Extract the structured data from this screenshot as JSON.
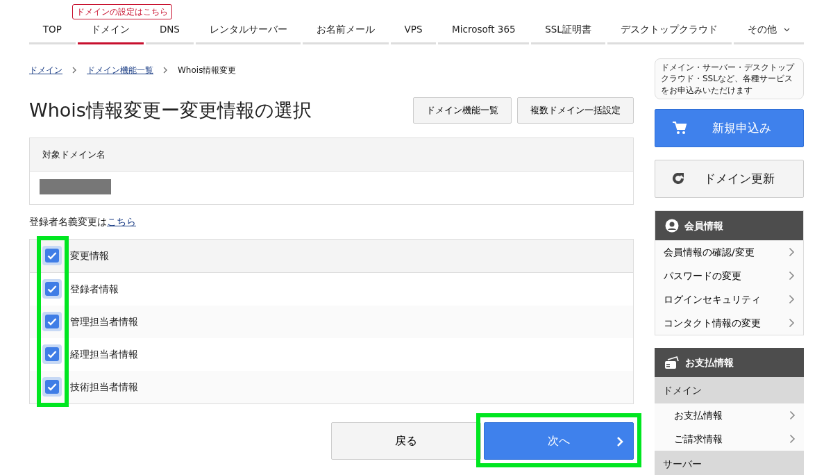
{
  "nav": {
    "tooltip": "ドメインの設定はこちら",
    "items": [
      {
        "label": "TOP",
        "selected": false
      },
      {
        "label": "ドメイン",
        "selected": true
      },
      {
        "label": "DNS",
        "selected": false
      },
      {
        "label": "レンタルサーバー",
        "selected": false
      },
      {
        "label": "お名前メール",
        "selected": false
      },
      {
        "label": "VPS",
        "selected": false
      },
      {
        "label": "Microsoft 365",
        "selected": false
      },
      {
        "label": "SSL証明書",
        "selected": false
      },
      {
        "label": "デスクトップクラウド",
        "selected": false
      },
      {
        "label": "その他",
        "selected": false,
        "dropdown": true
      }
    ]
  },
  "breadcrumb": [
    {
      "label": "ドメイン",
      "link": true
    },
    {
      "label": "ドメイン機能一覧",
      "link": true
    },
    {
      "label": "Whois情報変更",
      "link": false
    }
  ],
  "title": "Whois情報変更ー変更情報の選択",
  "header_buttons": [
    "ドメイン機能一覧",
    "複数ドメイン一括設定"
  ],
  "domain_panel": {
    "heading": "対象ドメイン名",
    "redacted": true
  },
  "registrant_note": {
    "text": "登録者名義変更は",
    "link": "こちら"
  },
  "options": {
    "highlighted": true,
    "items": [
      {
        "label": "変更情報",
        "checked": true,
        "kind": "header"
      },
      {
        "label": "登録者情報",
        "checked": true,
        "kind": "row"
      },
      {
        "label": "管理担当者情報",
        "checked": true,
        "kind": "row"
      },
      {
        "label": "経理担当者情報",
        "checked": true,
        "kind": "row"
      },
      {
        "label": "技術担当者情報",
        "checked": true,
        "kind": "row"
      }
    ]
  },
  "back_button": "戻る",
  "next_button": {
    "label": "次へ",
    "highlighted": true
  },
  "sidebar": {
    "bubble": "ドメイン・サーバー・デスクトップクラウド・SSLなど、各種サービスをお申込みいただけます",
    "apply_button": "新規申込み",
    "renew_button": "ドメイン更新",
    "member": {
      "heading": "会員情報",
      "items": [
        "会員情報の確認/変更",
        "パスワードの変更",
        "ログインセキュリティ",
        "コンタクト情報の変更"
      ]
    },
    "payment": {
      "heading": "お支払情報",
      "groups": [
        {
          "label": "ドメイン",
          "items": [
            "お支払情報",
            "ご請求情報"
          ]
        },
        {
          "label": "サーバー"
        }
      ]
    }
  }
}
